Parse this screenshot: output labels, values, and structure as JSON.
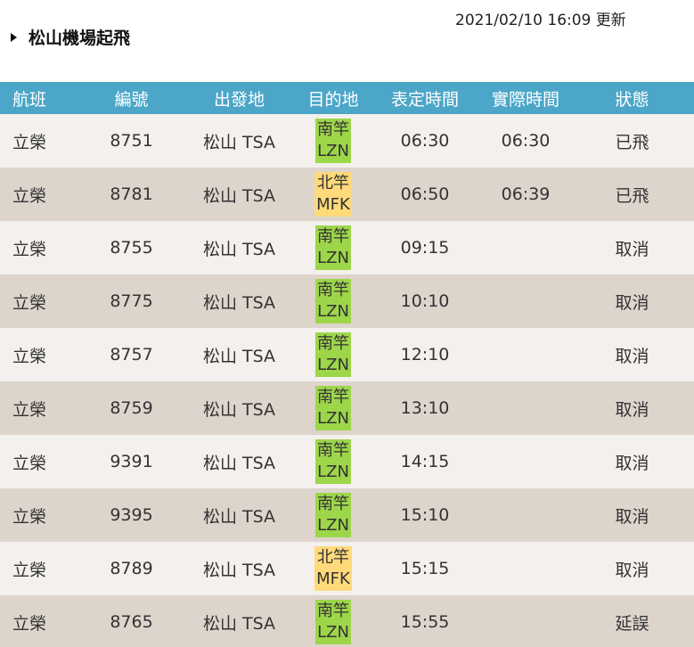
{
  "updated_text": "2021/02/10 16:09 更新",
  "section_title": "松山機場起飛",
  "columns": [
    "航班",
    "編號",
    "出發地",
    "目的地",
    "表定時間",
    "實際時間",
    "狀態"
  ],
  "colors": {
    "header_bg": "#4ba6c8",
    "row_light": "#f3f0ee",
    "row_dark": "#ddd4cc",
    "dest_green": "#9ed64a",
    "dest_yellow": "#ffd97a"
  },
  "flights": [
    {
      "airline": "立榮",
      "number": "8751",
      "origin": "松山 TSA",
      "dest_name": "南竿",
      "dest_code": "LZN",
      "dest_color": "green",
      "scheduled": "06:30",
      "actual": "06:30",
      "status": "已飛"
    },
    {
      "airline": "立榮",
      "number": "8781",
      "origin": "松山 TSA",
      "dest_name": "北竿",
      "dest_code": "MFK",
      "dest_color": "yellow",
      "scheduled": "06:50",
      "actual": "06:39",
      "status": "已飛"
    },
    {
      "airline": "立榮",
      "number": "8755",
      "origin": "松山 TSA",
      "dest_name": "南竿",
      "dest_code": "LZN",
      "dest_color": "green",
      "scheduled": "09:15",
      "actual": "",
      "status": "取消"
    },
    {
      "airline": "立榮",
      "number": "8775",
      "origin": "松山 TSA",
      "dest_name": "南竿",
      "dest_code": "LZN",
      "dest_color": "green",
      "scheduled": "10:10",
      "actual": "",
      "status": "取消"
    },
    {
      "airline": "立榮",
      "number": "8757",
      "origin": "松山 TSA",
      "dest_name": "南竿",
      "dest_code": "LZN",
      "dest_color": "green",
      "scheduled": "12:10",
      "actual": "",
      "status": "取消"
    },
    {
      "airline": "立榮",
      "number": "8759",
      "origin": "松山 TSA",
      "dest_name": "南竿",
      "dest_code": "LZN",
      "dest_color": "green",
      "scheduled": "13:10",
      "actual": "",
      "status": "取消"
    },
    {
      "airline": "立榮",
      "number": "9391",
      "origin": "松山 TSA",
      "dest_name": "南竿",
      "dest_code": "LZN",
      "dest_color": "green",
      "scheduled": "14:15",
      "actual": "",
      "status": "取消"
    },
    {
      "airline": "立榮",
      "number": "9395",
      "origin": "松山 TSA",
      "dest_name": "南竿",
      "dest_code": "LZN",
      "dest_color": "green",
      "scheduled": "15:10",
      "actual": "",
      "status": "取消"
    },
    {
      "airline": "立榮",
      "number": "8789",
      "origin": "松山 TSA",
      "dest_name": "北竿",
      "dest_code": "MFK",
      "dest_color": "yellow",
      "scheduled": "15:15",
      "actual": "",
      "status": "取消"
    },
    {
      "airline": "立榮",
      "number": "8765",
      "origin": "松山 TSA",
      "dest_name": "南竿",
      "dest_code": "LZN",
      "dest_color": "green",
      "scheduled": "15:55",
      "actual": "",
      "status": "延誤"
    }
  ]
}
